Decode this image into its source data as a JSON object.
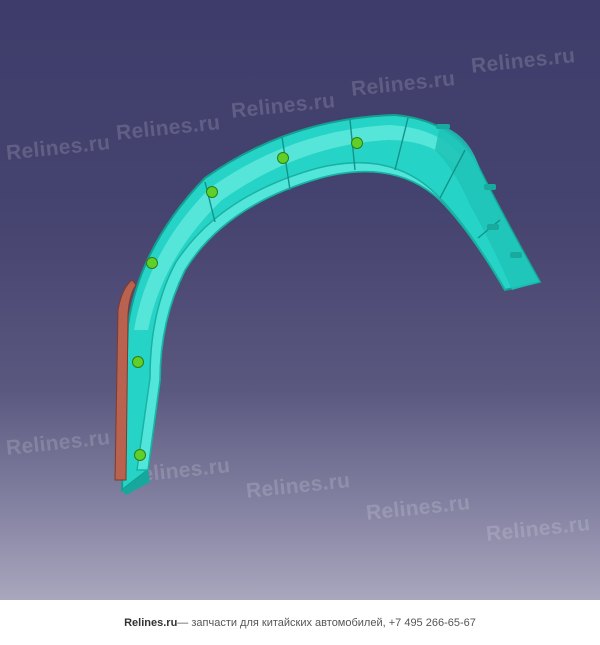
{
  "watermark": {
    "text": "Relines.ru"
  },
  "footer": {
    "brand": "Relines.ru",
    "tagline": " — запчасти для китайских автомобилей, +7 495 266-65-67"
  },
  "colors": {
    "part_body": "#25d4c6",
    "part_highlight": "#6ff0e6",
    "part_shadow": "#16a89c",
    "bracket": "#b8624f",
    "clips": "#5fd02a"
  }
}
